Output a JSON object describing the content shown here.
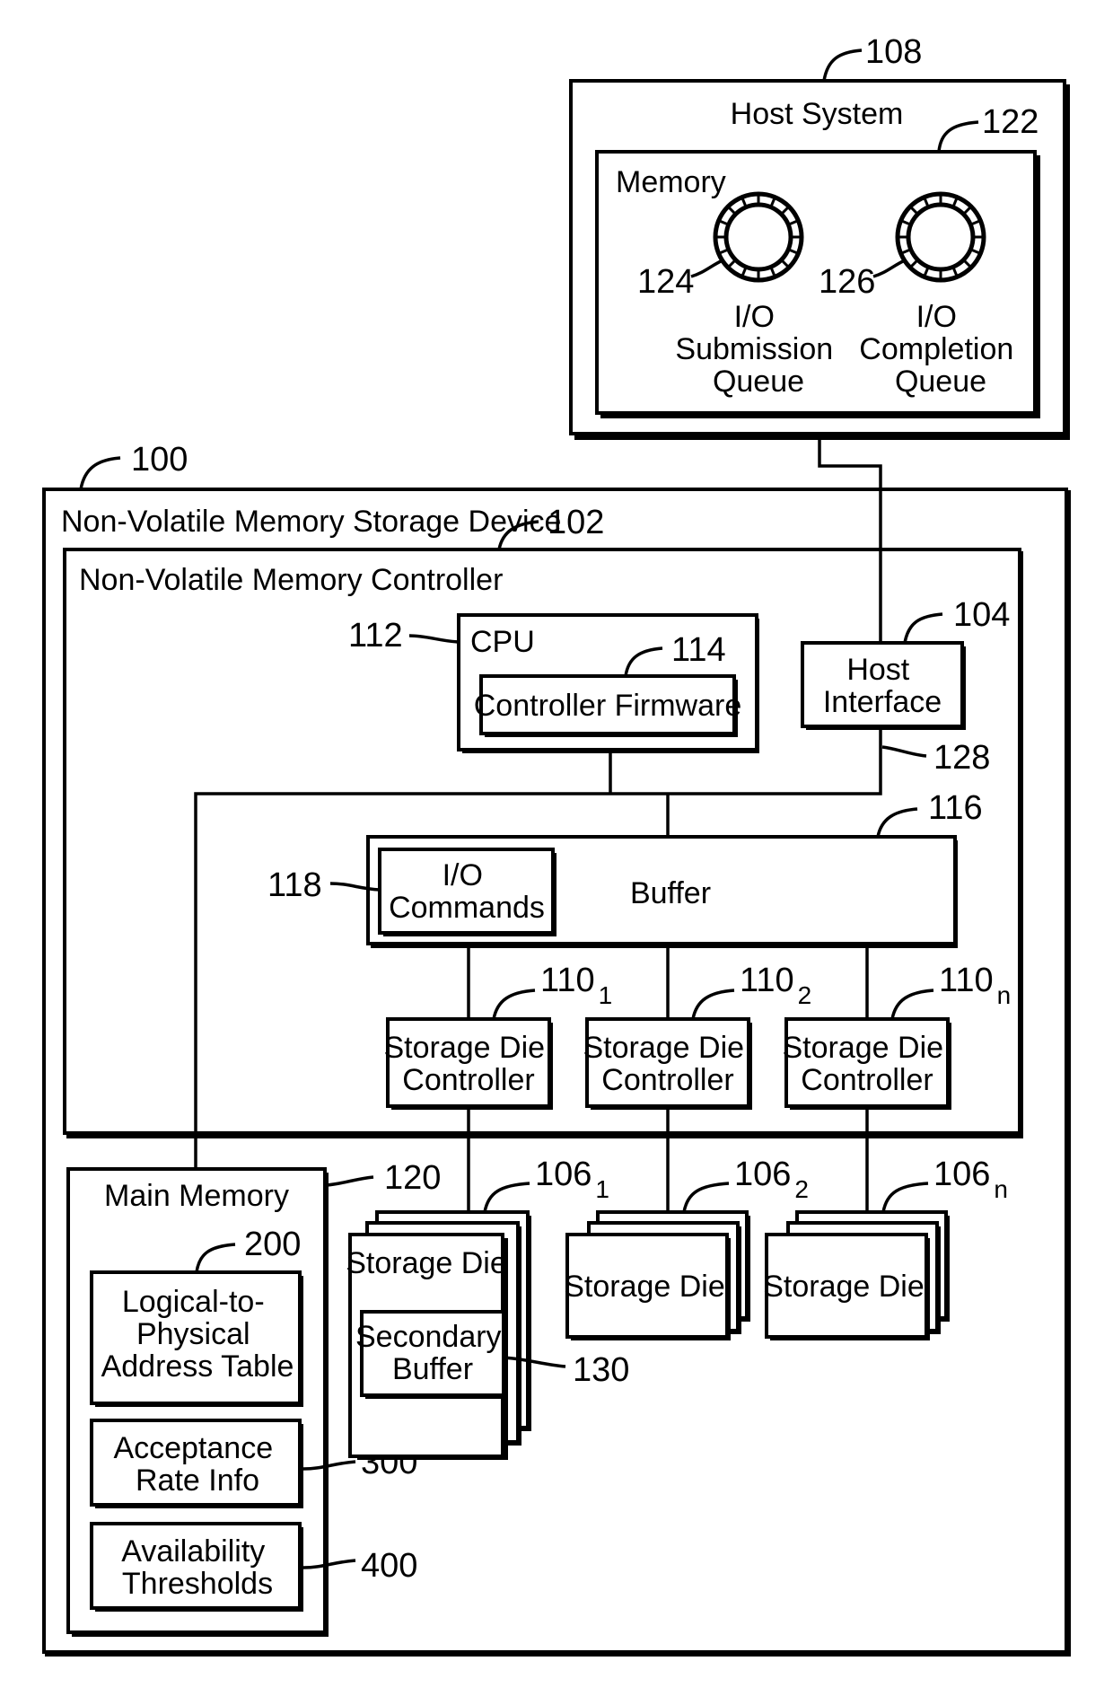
{
  "figure": {
    "host_system": {
      "label": "Host System",
      "ref": "108",
      "memory": {
        "label": "Memory",
        "ref": "122",
        "submission_queue": {
          "ref": "124",
          "lines": [
            "I/O",
            "Submission",
            "Queue"
          ]
        },
        "completion_queue": {
          "ref": "126",
          "lines": [
            "I/O",
            "Completion",
            "Queue"
          ]
        }
      }
    },
    "storage_device": {
      "label": "Non-Volatile Memory Storage Device",
      "ref": "100",
      "controller": {
        "label": "Non-Volatile Memory Controller",
        "ref": "102",
        "cpu": {
          "label": "CPU",
          "ref": "112",
          "firmware": {
            "label": "Controller Firmware",
            "ref": "114"
          }
        },
        "host_interface": {
          "lines": [
            "Host",
            "Interface"
          ],
          "ref": "104",
          "bus_ref": "128"
        },
        "buffer": {
          "label": "Buffer",
          "ref": "116",
          "io_commands": {
            "lines": [
              "I/O",
              "Commands"
            ],
            "ref": "118"
          }
        },
        "die_controllers": [
          {
            "lines": [
              "Storage Die",
              "Controller"
            ],
            "ref": "110",
            "sub": "1"
          },
          {
            "lines": [
              "Storage Die",
              "Controller"
            ],
            "ref": "110",
            "sub": "2"
          },
          {
            "lines": [
              "Storage Die",
              "Controller"
            ],
            "ref": "110",
            "sub": "n"
          }
        ]
      },
      "main_memory": {
        "label": "Main Memory",
        "ref": "120",
        "l2p_table": {
          "lines": [
            "Logical-to-",
            "Physical",
            "Address Table"
          ],
          "ref": "200"
        },
        "acceptance_rate": {
          "lines": [
            "Acceptance",
            "Rate Info"
          ],
          "ref": "300"
        },
        "availability": {
          "lines": [
            "Availability",
            "Thresholds"
          ],
          "ref": "400"
        }
      },
      "storage_dies": [
        {
          "label": "Storage Die",
          "ref": "106",
          "sub": "1",
          "secondary_buffer": {
            "lines": [
              "Secondary",
              "Buffer"
            ],
            "ref": "130"
          }
        },
        {
          "label": "Storage Die",
          "ref": "106",
          "sub": "2"
        },
        {
          "label": "Storage Die",
          "ref": "106",
          "sub": "n"
        }
      ]
    }
  }
}
